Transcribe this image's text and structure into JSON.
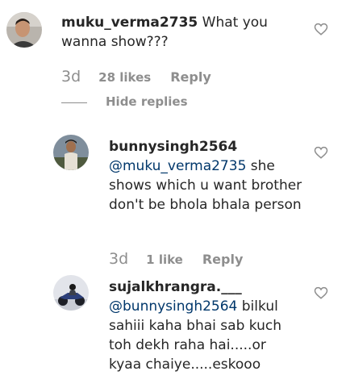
{
  "comments": [
    {
      "username": "muku_verma2735",
      "mention": "",
      "text": "What you wanna show???",
      "time": "3d",
      "likes": "28 likes",
      "reply_label": "Reply"
    },
    {
      "username": "bunnysingh2564",
      "mention": "@muku_verma2735",
      "text": "she shows which u want brother don't be bhola bhala person",
      "time": "3d",
      "likes": "1 like",
      "reply_label": "Reply"
    },
    {
      "username": "sujalkhrangra.___",
      "mention": "@bunnysingh2564",
      "text": "bilkul sahiii kaha bhai sab kuch toh dekh raha hai.....or kyaa chaiye.....eskooo",
      "time": "",
      "likes": "",
      "reply_label": ""
    }
  ],
  "hide_replies_label": "Hide replies",
  "colors": {
    "text": "#262626",
    "muted": "#8e8e8e",
    "mention": "#00376b"
  },
  "icons": {
    "like": "heart-outline-icon"
  }
}
